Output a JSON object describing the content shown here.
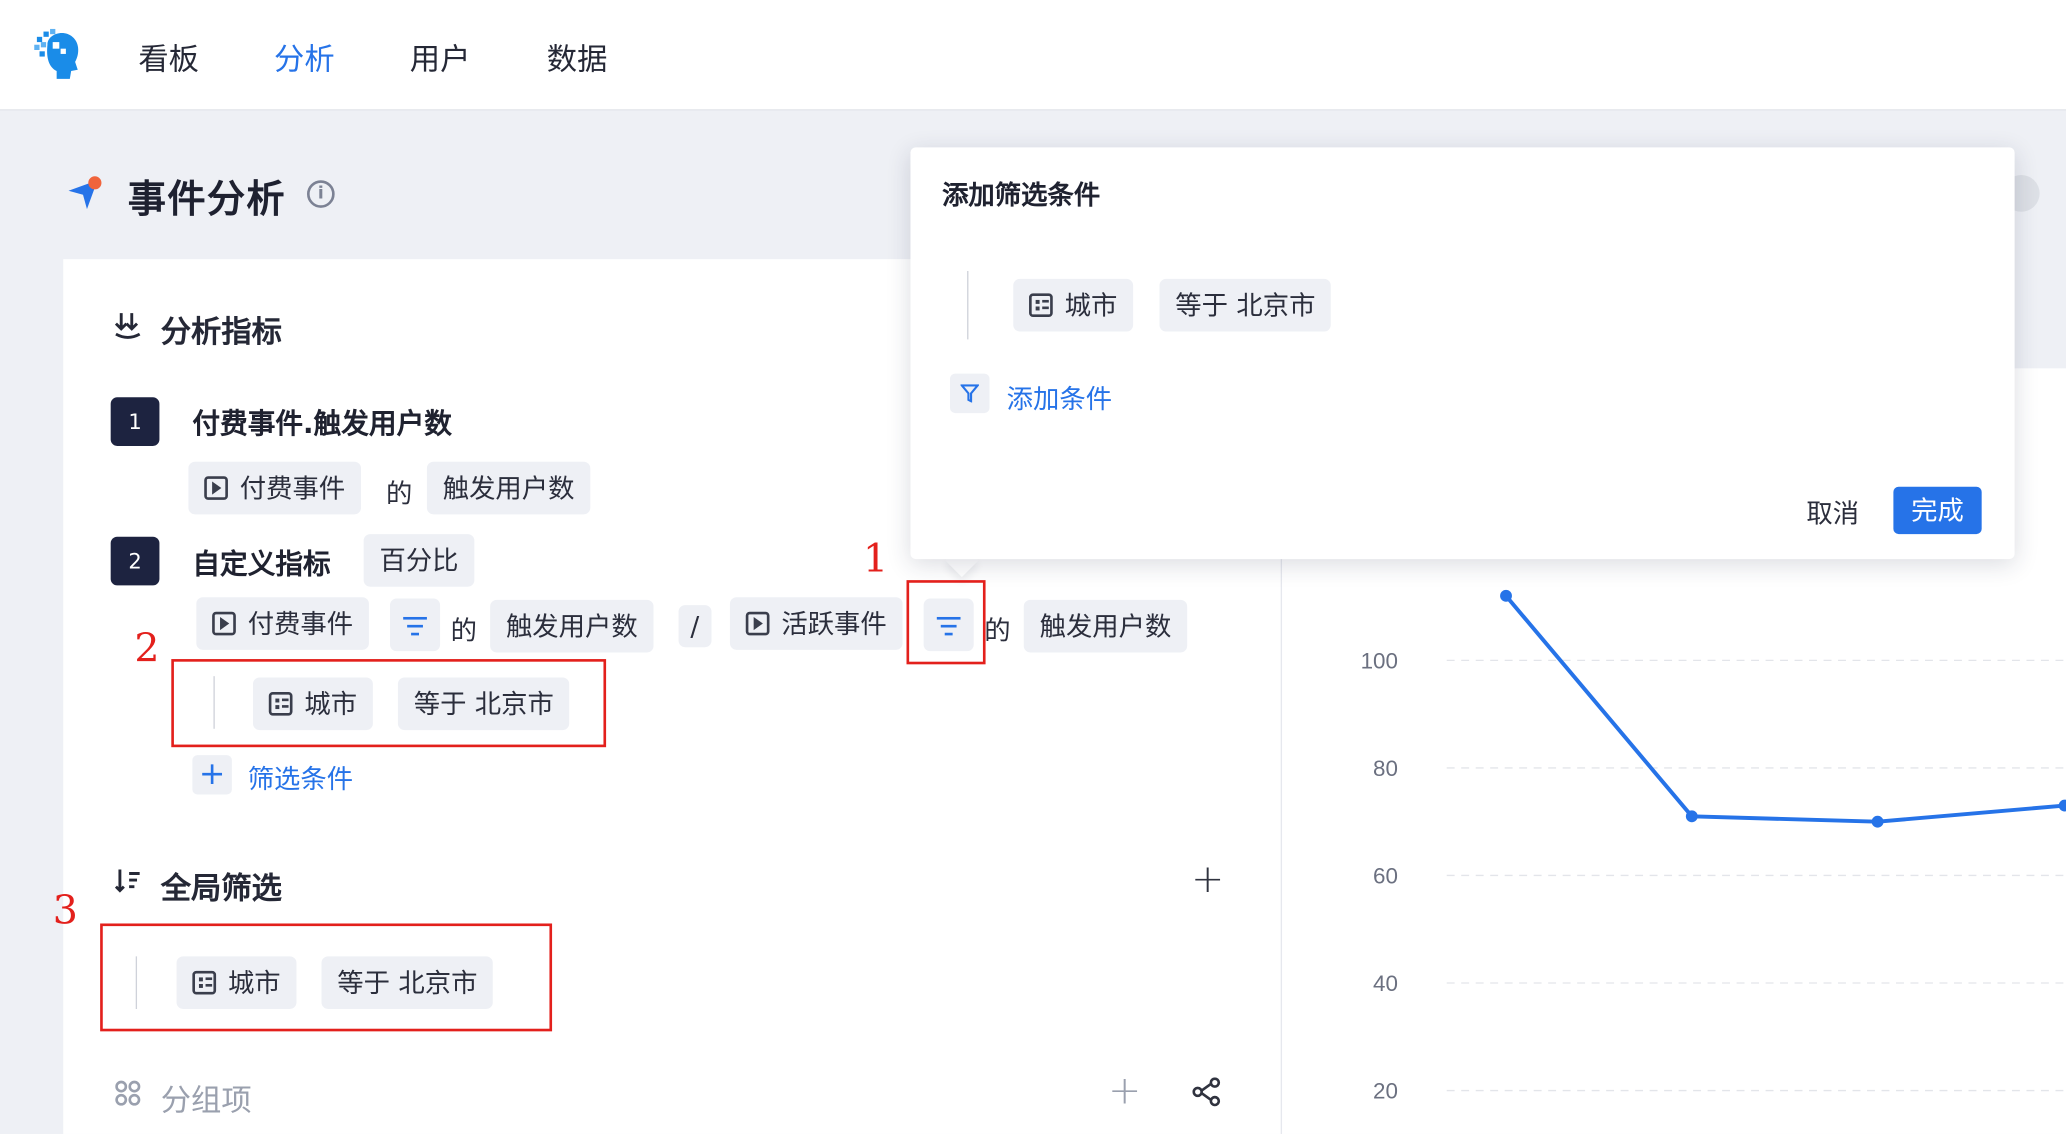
{
  "nav": {
    "items": [
      {
        "label": "看板",
        "active": false
      },
      {
        "label": "分析",
        "active": true
      },
      {
        "label": "用户",
        "active": false
      },
      {
        "label": "数据",
        "active": false
      }
    ]
  },
  "page": {
    "title": "事件分析",
    "info_icon": "info-icon"
  },
  "metrics_section": {
    "title": "分析指标",
    "metric1": {
      "index": "1",
      "name": "付费事件.触发用户数",
      "event": "付费事件",
      "of": "的",
      "measure": "触发用户数"
    },
    "metric2": {
      "index": "2",
      "name": "自定义指标",
      "format": "百分比",
      "numerator_event": "付费事件",
      "of1": "的",
      "numerator_measure": "触发用户数",
      "divide": "/",
      "denominator_event": "活跃事件",
      "of2": "的",
      "denominator_measure": "触发用户数",
      "filter": {
        "property": "城市",
        "condition": "等于 北京市"
      },
      "add_filter_label": "筛选条件"
    }
  },
  "global_filter": {
    "title": "全局筛选",
    "filter": {
      "property": "城市",
      "condition": "等于 北京市"
    }
  },
  "group_section": {
    "title": "分组项"
  },
  "popover": {
    "title": "添加筛选条件",
    "filter": {
      "property": "城市",
      "condition": "等于 北京市"
    },
    "add_condition_label": "添加条件",
    "cancel_label": "取消",
    "done_label": "完成"
  },
  "annotations": {
    "n1": "1",
    "n2": "2",
    "n3": "3"
  },
  "colors": {
    "accent": "#2673e8",
    "annotation": "#e3201c",
    "badge": "#1d2340"
  },
  "chart_data": {
    "type": "line",
    "y_ticks": [
      "100",
      "80",
      "60",
      "40",
      "20"
    ],
    "y_visible_range": [
      20,
      110
    ],
    "points": [
      112,
      71,
      70,
      73
    ]
  }
}
